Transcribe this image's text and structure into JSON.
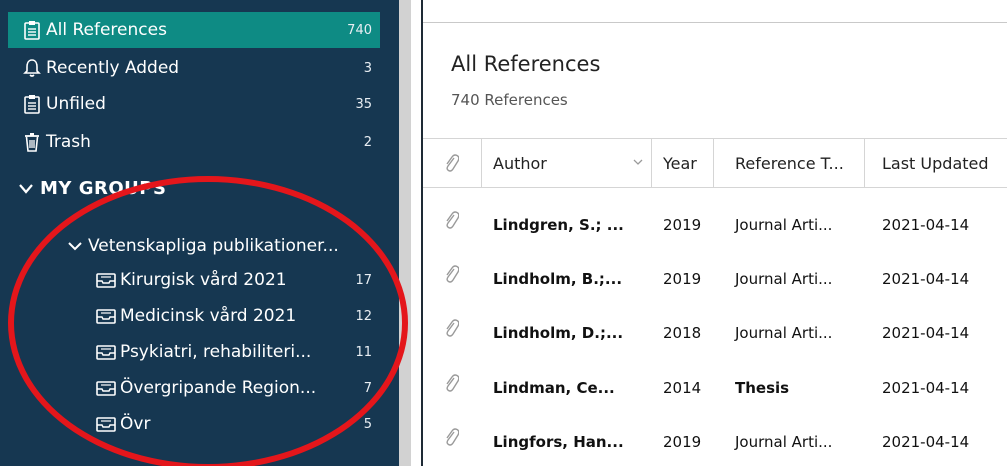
{
  "sidebar": {
    "items": [
      {
        "label": "All References",
        "count": "740",
        "icon": "clipboard-icon"
      },
      {
        "label": "Recently Added",
        "count": "3",
        "icon": "bell-icon"
      },
      {
        "label": "Unfiled",
        "count": "35",
        "icon": "clipboard-icon"
      },
      {
        "label": "Trash",
        "count": "2",
        "icon": "trash-icon"
      }
    ],
    "groups_header": "MY GROUPS",
    "subgroup": "Vetenskapliga publikationer...",
    "groups": [
      {
        "label": "Kirurgisk vård 2021",
        "count": "17"
      },
      {
        "label": "Medicinsk vård 2021",
        "count": "12"
      },
      {
        "label": "Psykiatri, rehabiliteri...",
        "count": "11"
      },
      {
        "label": "Övergripande Region...",
        "count": "7"
      },
      {
        "label": "Övr",
        "count": "5"
      }
    ]
  },
  "main": {
    "title": "All References",
    "subtitle": "740 References",
    "columns": {
      "author": "Author",
      "year": "Year",
      "reftype": "Reference T...",
      "updated": "Last Updated"
    },
    "rows": [
      {
        "author": "Lindgren, S.; ...",
        "year": "2019",
        "reftype": "Journal Arti...",
        "updated": "2021-04-14"
      },
      {
        "author": "Lindholm, B.;...",
        "year": "2019",
        "reftype": "Journal Arti...",
        "updated": "2021-04-14"
      },
      {
        "author": "Lindholm, D.;...",
        "year": "2018",
        "reftype": "Journal Arti...",
        "updated": "2021-04-14"
      },
      {
        "author": "Lindman, Ce...",
        "year": "2014",
        "reftype": "Thesis",
        "updated": "2021-04-14"
      },
      {
        "author": "Lingfors, Han...",
        "year": "2019",
        "reftype": "Journal Arti...",
        "updated": "2021-04-14"
      }
    ]
  },
  "colors": {
    "sidebar_bg": "#163751",
    "selected_bg": "#0e8b84",
    "annotation": "#e4161b"
  }
}
